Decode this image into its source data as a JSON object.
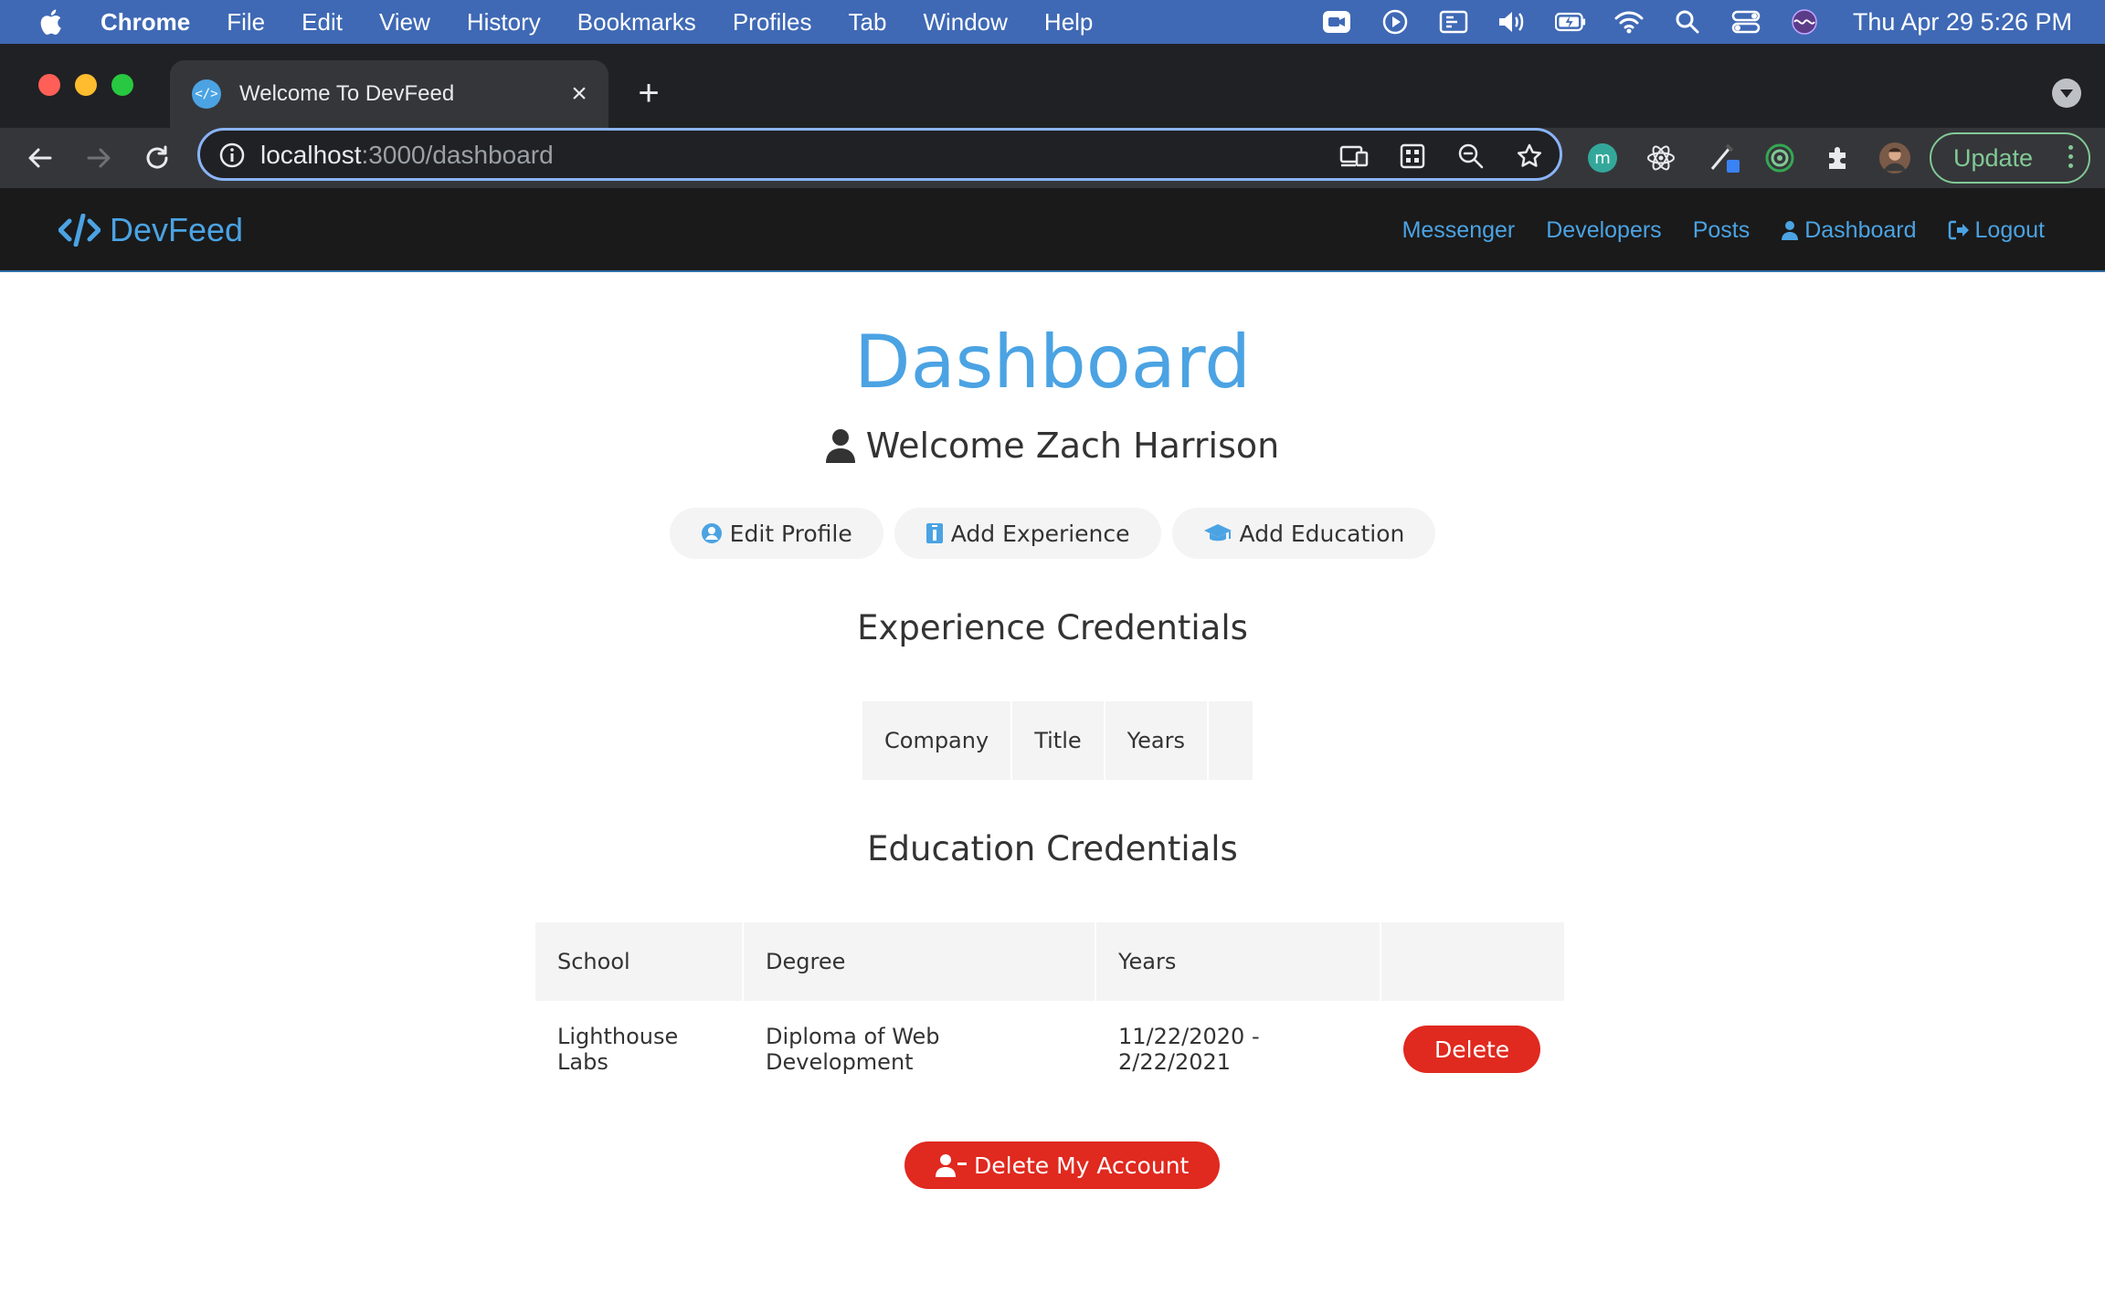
{
  "menubar": {
    "app": "Chrome",
    "items": [
      "File",
      "Edit",
      "View",
      "History",
      "Bookmarks",
      "Profiles",
      "Tab",
      "Window",
      "Help"
    ],
    "clock": "Thu Apr 29  5:26 PM"
  },
  "browser": {
    "tab_title": "Welcome To DevFeed",
    "url_host": "localhost",
    "url_path": ":3000/dashboard",
    "update_label": "Update"
  },
  "site": {
    "logo_text": "DevFeed",
    "nav": {
      "messenger": "Messenger",
      "developers": "Developers",
      "posts": "Posts",
      "dashboard": "Dashboard",
      "logout": "Logout"
    }
  },
  "dashboard": {
    "title": "Dashboard",
    "welcome": "Welcome Zach Harrison",
    "actions": {
      "edit_profile": "Edit Profile",
      "add_experience": "Add Experience",
      "add_education": "Add Education"
    },
    "experience": {
      "heading": "Experience Credentials",
      "headers": [
        "Company",
        "Title",
        "Years",
        ""
      ]
    },
    "education": {
      "heading": "Education Credentials",
      "headers": [
        "School",
        "Degree",
        "Years",
        ""
      ],
      "rows": [
        {
          "school": "Lighthouse Labs",
          "degree": "Diploma of Web Development",
          "years": "11/22/2020 - 2/22/2021",
          "delete_label": "Delete"
        }
      ]
    },
    "delete_account_label": "Delete My Account"
  },
  "colors": {
    "accent": "#4ba3e3",
    "danger": "#e0291f",
    "navbar": "#1a1a1a",
    "mac_menubar": "#3f69b5"
  }
}
